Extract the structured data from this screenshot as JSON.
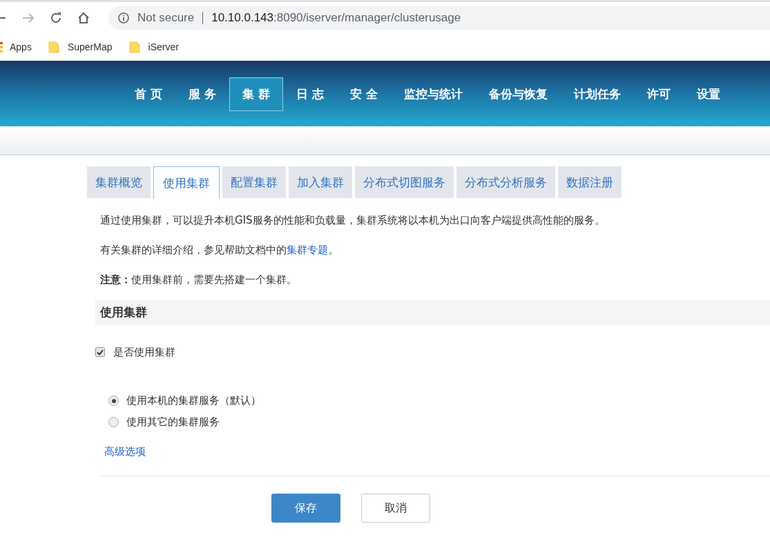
{
  "browser": {
    "security": "Not secure",
    "url_host": "10.10.0.143",
    "url_path": ":8090/iserver/manager/clusterusage"
  },
  "bookmarks": [
    {
      "kind": "apps",
      "label": "Apps"
    },
    {
      "kind": "folder",
      "label": "SuperMap"
    },
    {
      "kind": "folder",
      "label": "iServer"
    }
  ],
  "nav": [
    {
      "label": "首 页",
      "selected": false
    },
    {
      "label": "服 务",
      "selected": false
    },
    {
      "label": "集 群",
      "selected": true
    },
    {
      "label": "日 志",
      "selected": false
    },
    {
      "label": "安 全",
      "selected": false
    },
    {
      "label": "监控与统计",
      "selected": false
    },
    {
      "label": "备份与恢复",
      "selected": false
    },
    {
      "label": "计划任务",
      "selected": false
    },
    {
      "label": "许可",
      "selected": false
    },
    {
      "label": "设置",
      "selected": false
    }
  ],
  "tabs": [
    {
      "label": "集群概览",
      "selected": false
    },
    {
      "label": "使用集群",
      "selected": true
    },
    {
      "label": "配置集群",
      "selected": false
    },
    {
      "label": "加入集群",
      "selected": false
    },
    {
      "label": "分布式切图服务",
      "selected": false
    },
    {
      "label": "分布式分析服务",
      "selected": false
    },
    {
      "label": "数据注册",
      "selected": false
    }
  ],
  "intro": [
    {
      "text": "通过使用集群，可以提升本机GIS服务的性能和负载量，集群系统将以本机为出口向客户端提供高性能的服务。"
    },
    {
      "text": "有关集群的详细介绍，参见帮助文档中的",
      "link": "集群专题",
      "after": "。"
    },
    {
      "text": "**注意：**使用集群前，需要先搭建一个集群。"
    }
  ],
  "section_title": "使用集群",
  "use_cluster": {
    "label": "是否使用集群",
    "checked": true
  },
  "options": [
    {
      "label": "使用本机的集群服务（默认）",
      "selected": true
    },
    {
      "label": "使用其它的集群服务",
      "selected": false
    }
  ],
  "advanced_link": "高级选项",
  "buttons": [
    {
      "label": "保存",
      "kind": "primary"
    },
    {
      "label": "取消",
      "kind": "default"
    }
  ]
}
